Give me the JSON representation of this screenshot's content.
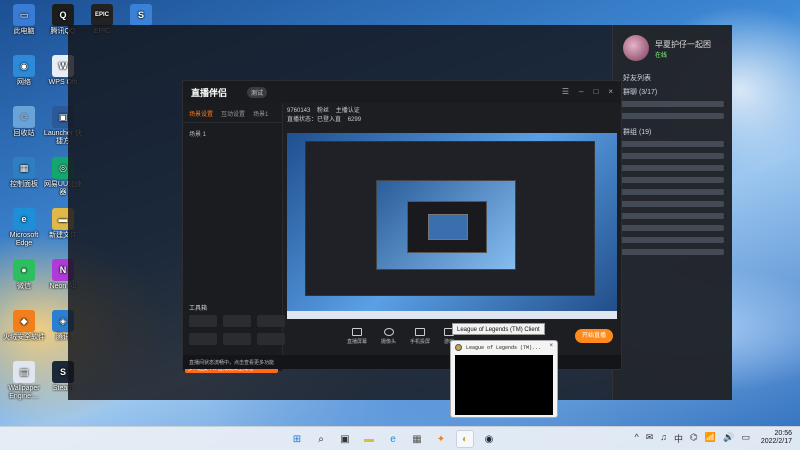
{
  "desktop": {
    "icons": [
      {
        "label": "此电脑",
        "color": "#3a7bd5",
        "glyph": "▭"
      },
      {
        "label": "腾讯QQ",
        "color": "#1d1d1d",
        "glyph": "Q"
      },
      {
        "label": "EPIC",
        "color": "#222222",
        "glyph": "EPIC"
      },
      {
        "label": "",
        "color": "#3b82d6",
        "glyph": "S"
      },
      {
        "label": "网络",
        "color": "#2c8ad8",
        "glyph": "◉"
      },
      {
        "label": "WPS Offi",
        "color": "#e8eef5",
        "glyph": "W"
      },
      {
        "label": "回收站",
        "color": "#6aa3d8",
        "glyph": "♲"
      },
      {
        "label": "Launcher 快捷方",
        "color": "#2a5a9a",
        "glyph": "▣"
      },
      {
        "label": "控制面板",
        "color": "#2f7fc0",
        "glyph": "▦"
      },
      {
        "label": "网易UU加速器",
        "color": "#13a66f",
        "glyph": "◎"
      },
      {
        "label": "Microsoft Edge",
        "color": "#1c8fd8",
        "glyph": "e"
      },
      {
        "label": "新建文件",
        "color": "#e0b84a",
        "glyph": "▬"
      },
      {
        "label": "微信",
        "color": "#2dbe60",
        "glyph": "●"
      },
      {
        "label": "Neon Ab",
        "color": "#b03ad8",
        "glyph": "N"
      },
      {
        "label": "火绒安全软件",
        "color": "#f07f1c",
        "glyph": "◆"
      },
      {
        "label": "腾讯",
        "color": "#2b7ed0",
        "glyph": "◈"
      },
      {
        "label": "Wallpaper Engine:...",
        "color": "#dfe6ef",
        "glyph": "▤"
      },
      {
        "label": "Steam",
        "color": "#1b2838",
        "glyph": "S"
      }
    ]
  },
  "qq": {
    "name": "早夏护仔一起困",
    "status": "在线",
    "friends_header": "好友列表",
    "group_header": "群聊 (3/17)",
    "group2_header": "群组 (19)"
  },
  "app": {
    "title": "直播伴侣",
    "version_badge": "测试",
    "tabs": [
      "场景设置",
      "互动设置",
      "场景1"
    ],
    "scene_item": "场景 1",
    "tools_title": "工具箱",
    "promo_text": "多人连麦·PK·连线玩法上线啦",
    "notice_text": "直播间状态流畅中，点击查看更多功能",
    "info": {
      "room": "9760143",
      "fans": "粉丝",
      "tag": "主播认证",
      "status_label": "直播状态：已登入直",
      "likes": "6299"
    },
    "bottom_buttons": [
      "直播屏幕",
      "摄像头",
      "手机投屏",
      "游戏"
    ],
    "start_live": "开始直播"
  },
  "tooltip": "League of Legends (TM) Client",
  "thumbnail": {
    "title": "League of Legends (TM)...",
    "close": "×"
  },
  "taskbar": {
    "apps": [
      {
        "name": "windows",
        "glyph": "⊞",
        "color": "#1a73d9"
      },
      {
        "name": "search",
        "glyph": "⌕",
        "color": "#222222"
      },
      {
        "name": "task-view",
        "glyph": "▣",
        "color": "#333333"
      },
      {
        "name": "file-explorer",
        "glyph": "▬",
        "color": "#e0b84a"
      },
      {
        "name": "edge",
        "glyph": "e",
        "color": "#1c8fd8"
      },
      {
        "name": "store",
        "glyph": "▦",
        "color": "#555555"
      },
      {
        "name": "streamer",
        "glyph": "✦",
        "color": "#f07f1c"
      },
      {
        "name": "league",
        "glyph": "◐",
        "color": "#c7a34a"
      },
      {
        "name": "steam",
        "glyph": "◉",
        "color": "#1b2838"
      }
    ],
    "tray_icons": [
      "^",
      "✉",
      "♫",
      "中",
      "⌬",
      "📶",
      "🔊",
      "▭"
    ],
    "time": "20:56",
    "date": "2022/2/17"
  }
}
